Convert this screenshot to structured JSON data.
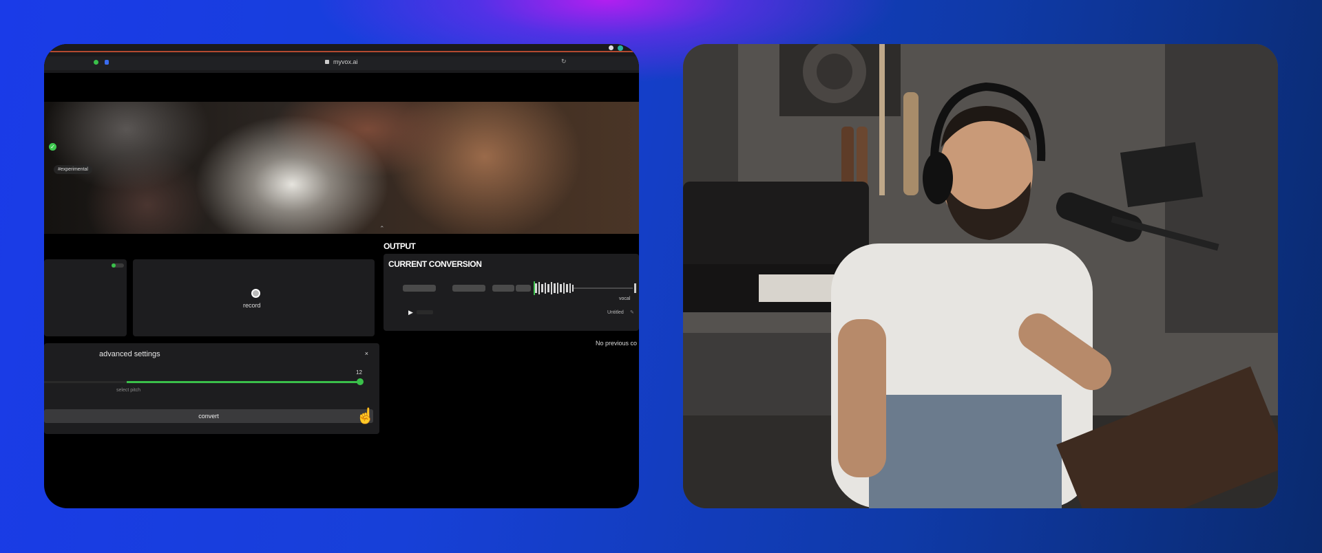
{
  "browser": {
    "url": "myvox.ai"
  },
  "hero": {
    "tag": "#experimental"
  },
  "input": {
    "record_label": "record"
  },
  "advanced": {
    "title": "advanced settings",
    "close": "×",
    "pitch_value": "12",
    "pitch_fraction": 1.0,
    "pitch_label": "select pitch",
    "convert_label": "convert"
  },
  "output": {
    "section_title": "OUTPUT",
    "current_title": "CURRENT CONVERSION",
    "vocals_label": "vocal",
    "play_icon": "▶",
    "file_name": "Untitled",
    "no_previous": "No previous co"
  },
  "colors": {
    "accent": "#3ac04a"
  }
}
